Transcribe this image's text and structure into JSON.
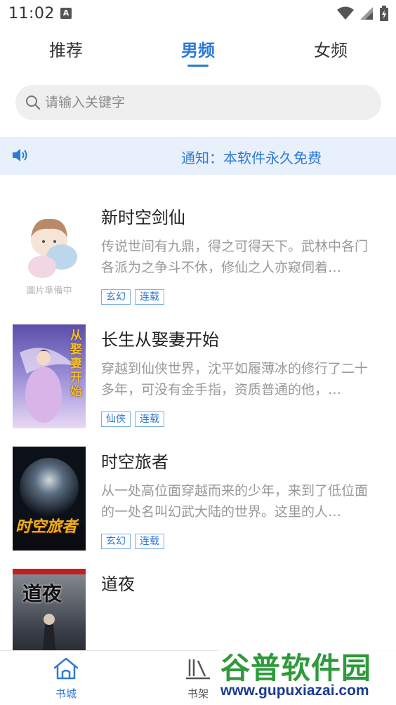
{
  "status_bar": {
    "time": "11:02",
    "badge": "A"
  },
  "tabs": [
    {
      "label": "推荐",
      "active": false
    },
    {
      "label": "男频",
      "active": true
    },
    {
      "label": "女频",
      "active": false
    }
  ],
  "search": {
    "placeholder": "请输入关键字"
  },
  "notice": {
    "text": "通知：本软件永久免费"
  },
  "books": [
    {
      "title": "新时空剑仙",
      "desc": "传说世间有九鼎，得之可得天下。武林中各门各派为之争斗不休，修仙之人亦窥伺着…",
      "tags": [
        "玄幻",
        "连载"
      ],
      "cover_placeholder": "圖片準備中"
    },
    {
      "title": "长生从娶妻开始",
      "desc": "穿越到仙侠世界，沈平如履薄冰的修行了二十多年，可没有金手指，资质普通的他，…",
      "tags": [
        "仙侠",
        "连载"
      ],
      "cover_text": "从娶妻开始"
    },
    {
      "title": "时空旅者",
      "desc": "从一处高位面穿越而来的少年，来到了低位面的一处名叫幻武大陆的世界。这里的人…",
      "tags": [
        "玄幻",
        "连载"
      ],
      "cover_text": "时空旅者"
    },
    {
      "title": "道夜",
      "desc": "",
      "tags": [],
      "cover_text": "道夜"
    }
  ],
  "bottom_nav": [
    {
      "label": "书城",
      "icon": "home-icon",
      "active": true
    },
    {
      "label": "书架",
      "icon": "bookshelf-icon",
      "active": false
    }
  ],
  "watermark": {
    "main": "谷普软件园",
    "url": "www.gupuxiazai.com"
  },
  "colors": {
    "accent": "#2d7ad6",
    "notice_bg": "#e7f0fb",
    "search_bg": "#efefef"
  }
}
